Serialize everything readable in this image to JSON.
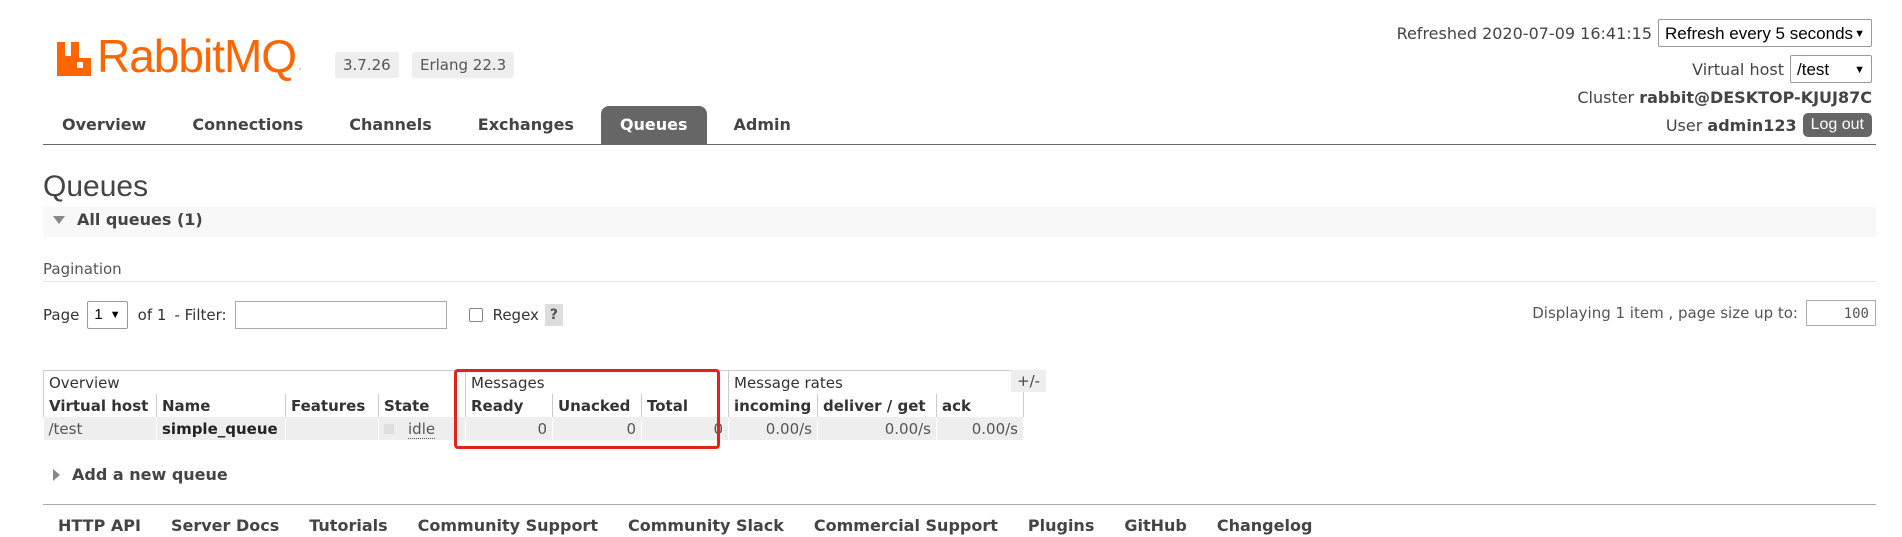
{
  "brand": {
    "name": "RabbitMQ",
    "trademark": ".",
    "version": "3.7.26",
    "erlang": "Erlang 22.3",
    "color": "#ff6600"
  },
  "header": {
    "refreshed_label": "Refreshed 2020-07-09 16:41:15",
    "refresh_option": "Refresh every 5 seconds",
    "vhost_label": "Virtual host",
    "vhost_value": "/test",
    "cluster_label": "Cluster",
    "cluster_value": "rabbit@DESKTOP-KJUJ87C",
    "user_label": "User",
    "user_value": "admin123",
    "logout_label": "Log out"
  },
  "nav": {
    "tabs": [
      "Overview",
      "Connections",
      "Channels",
      "Exchanges",
      "Queues",
      "Admin"
    ],
    "active": "Queues"
  },
  "page": {
    "title": "Queues",
    "section_title": "All queues (1)",
    "pagination_label": "Pagination",
    "page_label": "Page",
    "page_value": "1",
    "of_label": "of 1",
    "filter_label": "- Filter:",
    "regex_label": "Regex",
    "help_label": "?",
    "display_label": "Displaying 1 item , page size up to:",
    "page_size": "100"
  },
  "table": {
    "groups": [
      "Overview",
      "Messages",
      "Message rates"
    ],
    "plus_minus": "+/-",
    "columns": [
      "Virtual host",
      "Name",
      "Features",
      "State",
      "Ready",
      "Unacked",
      "Total",
      "incoming",
      "deliver / get",
      "ack"
    ],
    "rows": [
      {
        "vhost": "/test",
        "name": "simple_queue",
        "features": "",
        "state": "idle",
        "ready": "0",
        "unacked": "0",
        "total": "0",
        "incoming": "0.00/s",
        "deliver_get": "0.00/s",
        "ack": "0.00/s"
      }
    ]
  },
  "add_queue_label": "Add a new queue",
  "footer": [
    "HTTP API",
    "Server Docs",
    "Tutorials",
    "Community Support",
    "Community Slack",
    "Commercial Support",
    "Plugins",
    "GitHub",
    "Changelog"
  ]
}
